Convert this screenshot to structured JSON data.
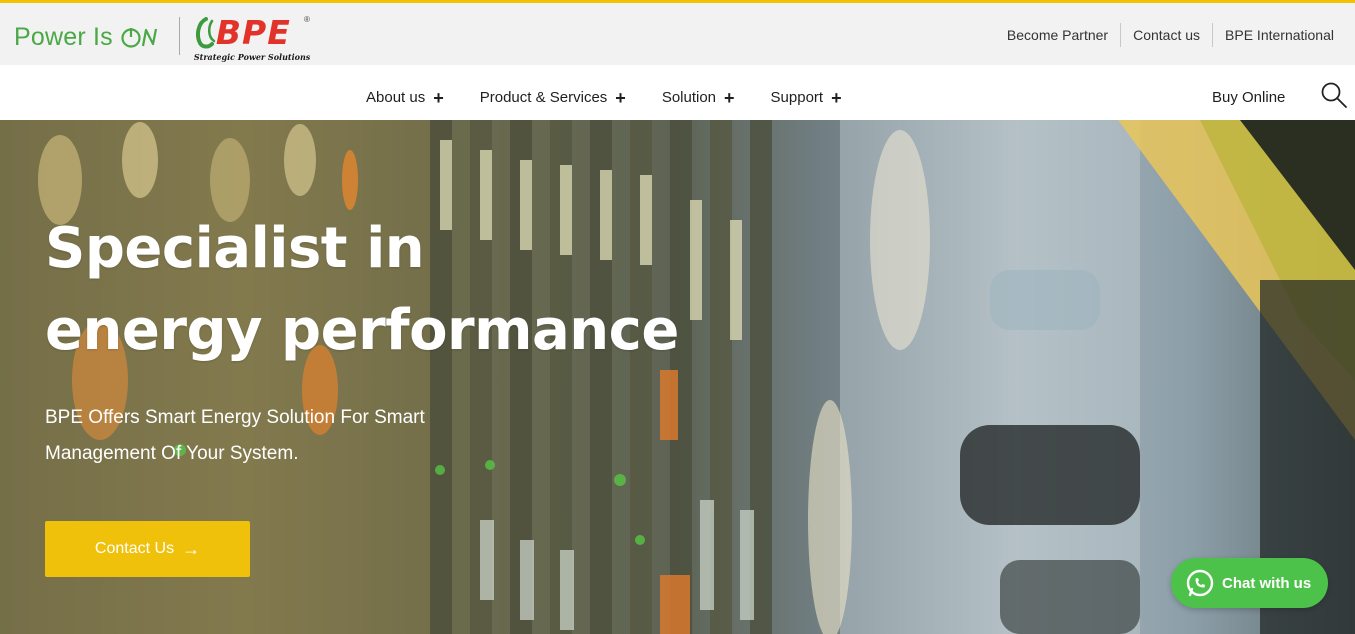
{
  "header": {
    "tagline": "Power Is",
    "tagline_mark": "ON",
    "logo_text": "BPE",
    "logo_subtitle": "Strategic Power Solutions",
    "logo_registered": "®",
    "top_links": [
      "Become Partner",
      "Contact us",
      "BPE International"
    ]
  },
  "nav": {
    "items": [
      {
        "label": "About us",
        "icon": "plus-icon"
      },
      {
        "label": "Product & Services",
        "icon": "plus-icon"
      },
      {
        "label": "Solution",
        "icon": "plus-icon"
      },
      {
        "label": "Support",
        "icon": "plus-icon"
      }
    ],
    "plus_glyph": "+",
    "buy_online": "Buy Online",
    "search_icon": "search-icon"
  },
  "hero": {
    "title_line1": "Specialist in",
    "title_line2": "energy performance",
    "subtitle_line1": "BPE Offers Smart Energy Solution For Smart",
    "subtitle_line2": "Management Of Your System.",
    "cta_label": "Contact Us",
    "cta_arrow": "→"
  },
  "chat": {
    "label": "Chat with us",
    "icon": "whatsapp-icon"
  },
  "colors": {
    "accent_yellow": "#f0c10a",
    "brand_green": "#4aa845",
    "brand_red": "#e2332a",
    "chat_green": "#4dc24b"
  }
}
